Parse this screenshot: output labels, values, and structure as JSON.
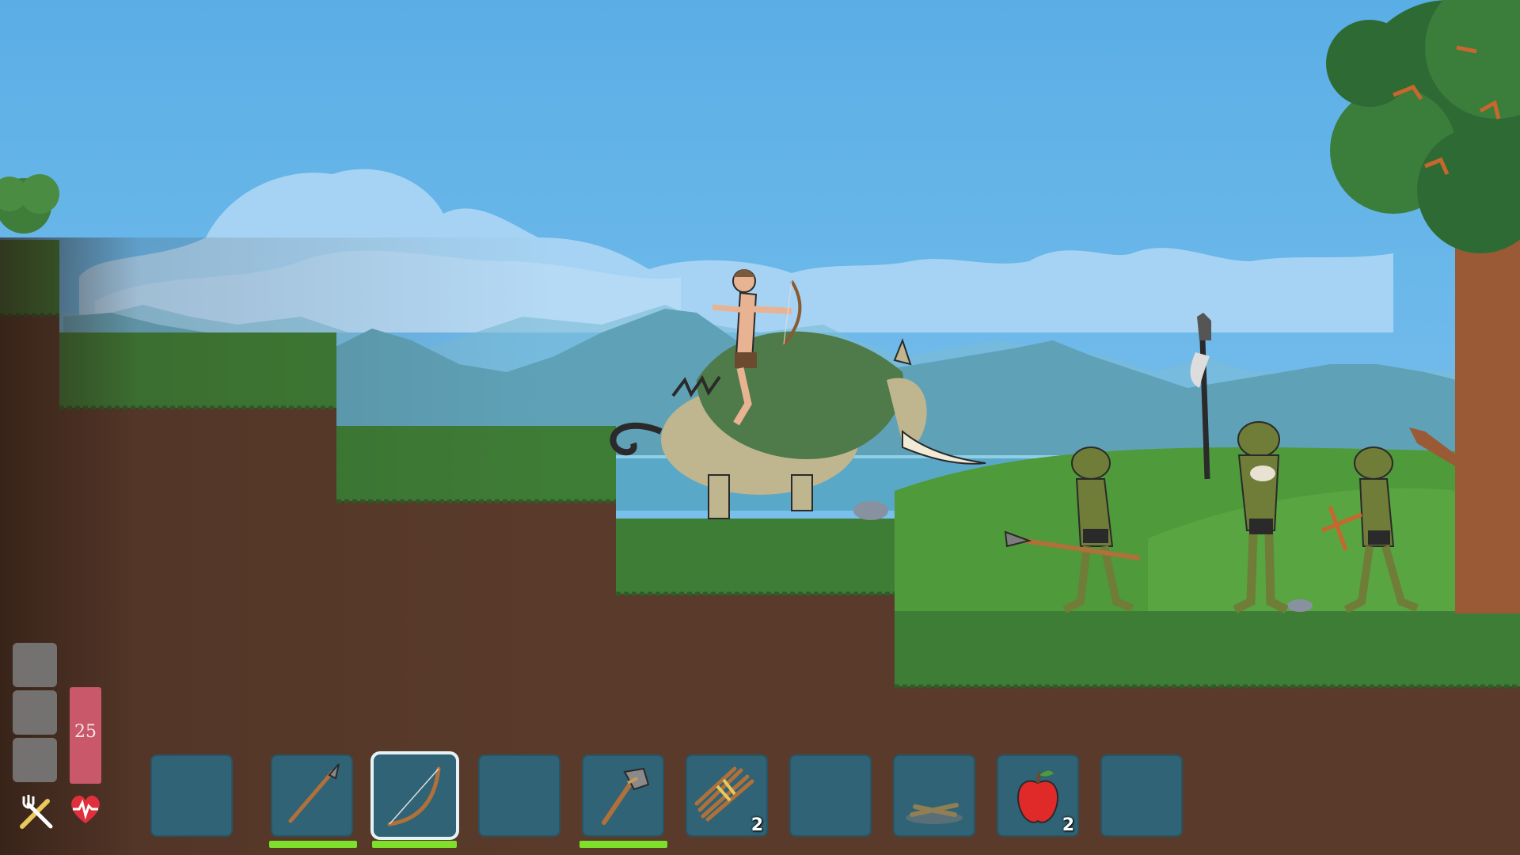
{
  "player": {
    "health": 25,
    "health_max": 25,
    "hunger_cells": 3,
    "hunger_filled": 0
  },
  "icons": {
    "hunger": "fork-knife-icon",
    "health": "heart-icon"
  },
  "hotbar": {
    "selected_index": 2,
    "slots": [
      {
        "item": "",
        "count": "",
        "durability": null
      },
      {
        "item": "spear-icon",
        "count": "",
        "durability": 1.0
      },
      {
        "item": "bow-icon",
        "count": "",
        "durability": 1.0
      },
      {
        "item": "",
        "count": "",
        "durability": null
      },
      {
        "item": "stone-axe-icon",
        "count": "",
        "durability": 1.0
      },
      {
        "item": "sticks-bundle-icon",
        "count": "2",
        "durability": null
      },
      {
        "item": "",
        "count": "",
        "durability": null
      },
      {
        "item": "campfire-icon",
        "count": "",
        "durability": null
      },
      {
        "item": "apple-icon",
        "count": "2",
        "durability": null
      },
      {
        "item": "",
        "count": "",
        "durability": null
      }
    ]
  },
  "colors": {
    "sky": "#5eb3e8",
    "grass": "#3e7d36",
    "dirt": "#5a3b2b",
    "slot": "#2f6375",
    "health": "#c9586a",
    "durability": "#7ee02a"
  }
}
